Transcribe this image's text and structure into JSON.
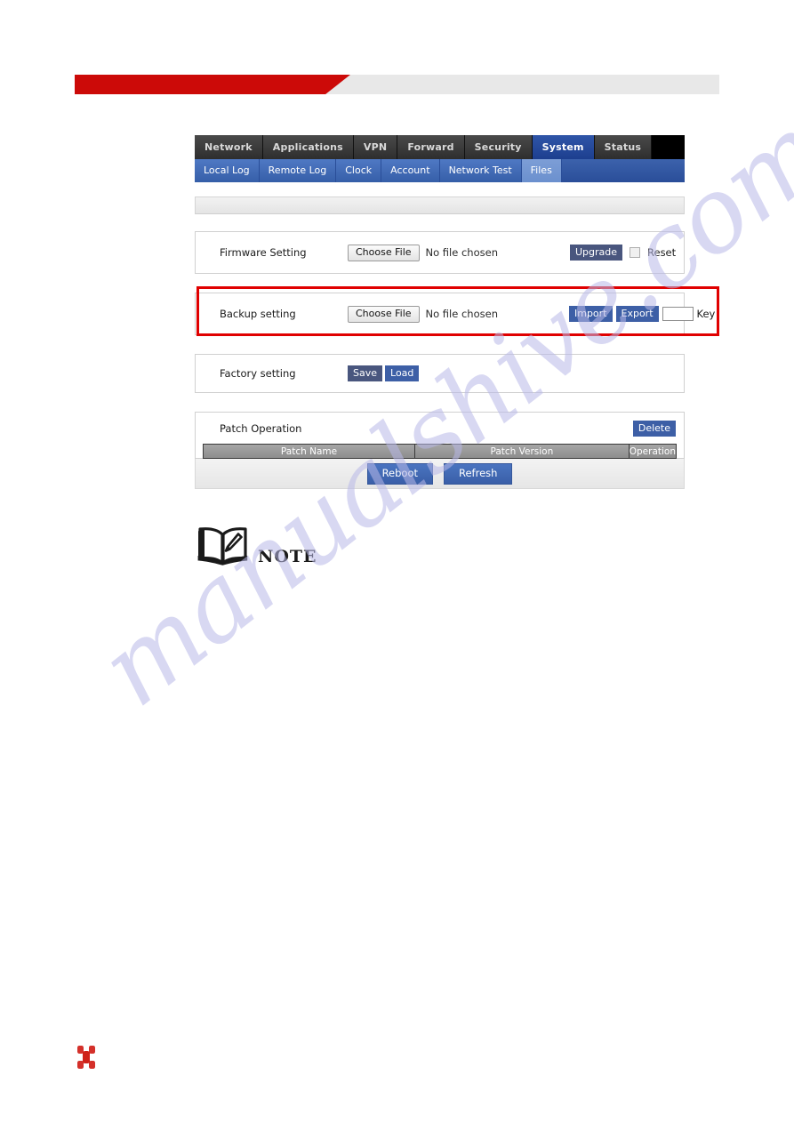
{
  "document": {
    "note_label": "NOTE",
    "watermark": "manualshive.com"
  },
  "router_ui": {
    "top_nav": [
      {
        "label": "Network",
        "active": false
      },
      {
        "label": "Applications",
        "active": false
      },
      {
        "label": "VPN",
        "active": false
      },
      {
        "label": "Forward",
        "active": false
      },
      {
        "label": "Security",
        "active": false
      },
      {
        "label": "System",
        "active": true
      },
      {
        "label": "Status",
        "active": false
      }
    ],
    "sub_nav": [
      {
        "label": "Local Log",
        "active": false
      },
      {
        "label": "Remote Log",
        "active": false
      },
      {
        "label": "Clock",
        "active": false
      },
      {
        "label": "Account",
        "active": false
      },
      {
        "label": "Network Test",
        "active": false
      },
      {
        "label": "Files",
        "active": true
      }
    ],
    "firmware": {
      "label": "Firmware Setting",
      "choose_file": "Choose File",
      "file_status": "No file chosen",
      "upgrade_button": "Upgrade",
      "reset_label": "Reset"
    },
    "backup": {
      "label": "Backup setting",
      "choose_file": "Choose File",
      "file_status": "No file chosen",
      "import_button": "Import",
      "export_button": "Export",
      "key_value": "",
      "key_label": "Key"
    },
    "factory": {
      "label": "Factory setting",
      "save_button": "Save",
      "load_button": "Load"
    },
    "patch": {
      "label": "Patch Operation",
      "delete_button": "Delete",
      "columns": [
        "Patch Name",
        "Patch Version",
        "Operation"
      ]
    },
    "footer": {
      "reboot_button": "Reboot",
      "refresh_button": "Refresh"
    }
  },
  "colors": {
    "brand_red": "#cc0a08",
    "annotation_red": "#e00000",
    "nav_blue": "#2f55a8",
    "button_blue": "#3d5fa6",
    "table_gray": "#9a9a9a"
  }
}
